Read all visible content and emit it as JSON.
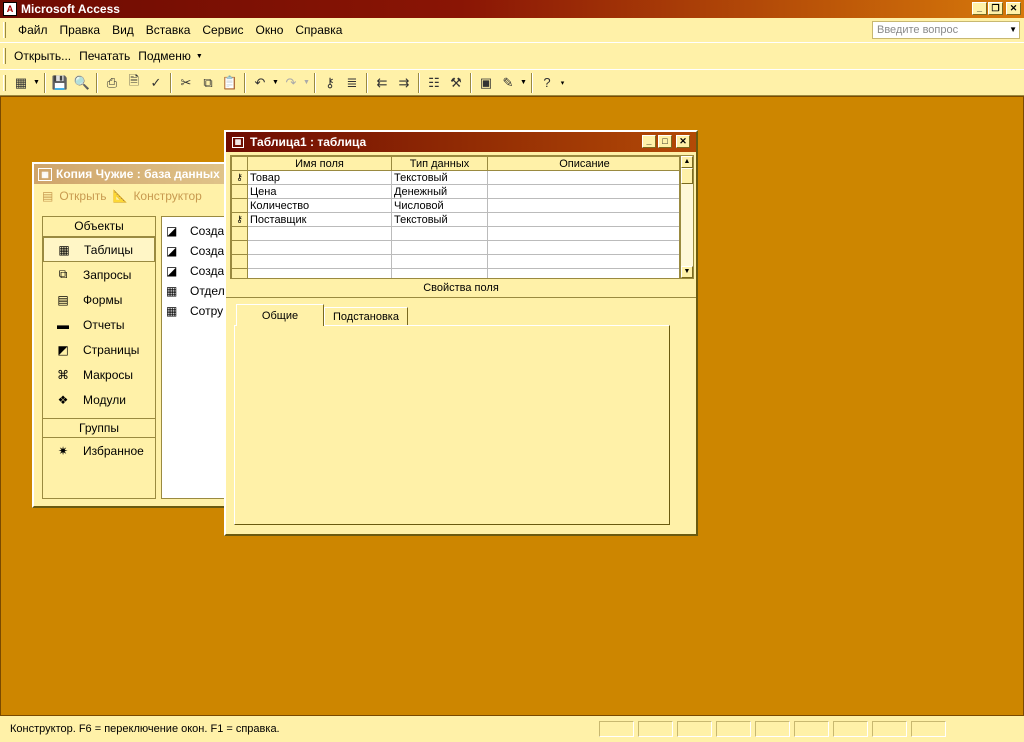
{
  "app": {
    "title": "Microsoft Access"
  },
  "menu": [
    "Файл",
    "Правка",
    "Вид",
    "Вставка",
    "Сервис",
    "Окно",
    "Справка"
  ],
  "help_placeholder": "Введите вопрос",
  "toolbar1": {
    "open": "Открыть...",
    "print": "Печатать",
    "submenu": "Подменю"
  },
  "db_window": {
    "title": "Копия Чужие : база данных",
    "open_label": "Открыть",
    "design_label": "Конструктор",
    "objects_header": "Объекты",
    "objects": [
      {
        "label": "Таблицы",
        "icon": "table-icon"
      },
      {
        "label": "Запросы",
        "icon": "query-icon"
      },
      {
        "label": "Формы",
        "icon": "form-icon"
      },
      {
        "label": "Отчеты",
        "icon": "report-icon"
      },
      {
        "label": "Страницы",
        "icon": "page-icon"
      },
      {
        "label": "Макросы",
        "icon": "macro-icon"
      },
      {
        "label": "Модули",
        "icon": "module-icon"
      }
    ],
    "groups_header": "Группы",
    "favorites": "Избранное",
    "list_items": [
      "Созда",
      "Созда",
      "Созда",
      "Отдел",
      "Сотру"
    ]
  },
  "table_window": {
    "title": "Таблица1 : таблица",
    "columns": [
      "Имя поля",
      "Тип данных",
      "Описание"
    ],
    "rows": [
      {
        "key": true,
        "name": "Товар",
        "type": "Текстовый",
        "desc": ""
      },
      {
        "key": false,
        "name": "Цена",
        "type": "Денежный",
        "desc": ""
      },
      {
        "key": false,
        "name": "Количество",
        "type": "Числовой",
        "desc": ""
      },
      {
        "key": true,
        "name": "Поставщик",
        "type": "Текстовый",
        "desc": ""
      }
    ],
    "properties_label": "Свойства поля",
    "tabs": [
      "Общие",
      "Подстановка"
    ]
  },
  "status": {
    "text": "Конструктор.  F6 = переключение окон.  F1 = справка."
  }
}
